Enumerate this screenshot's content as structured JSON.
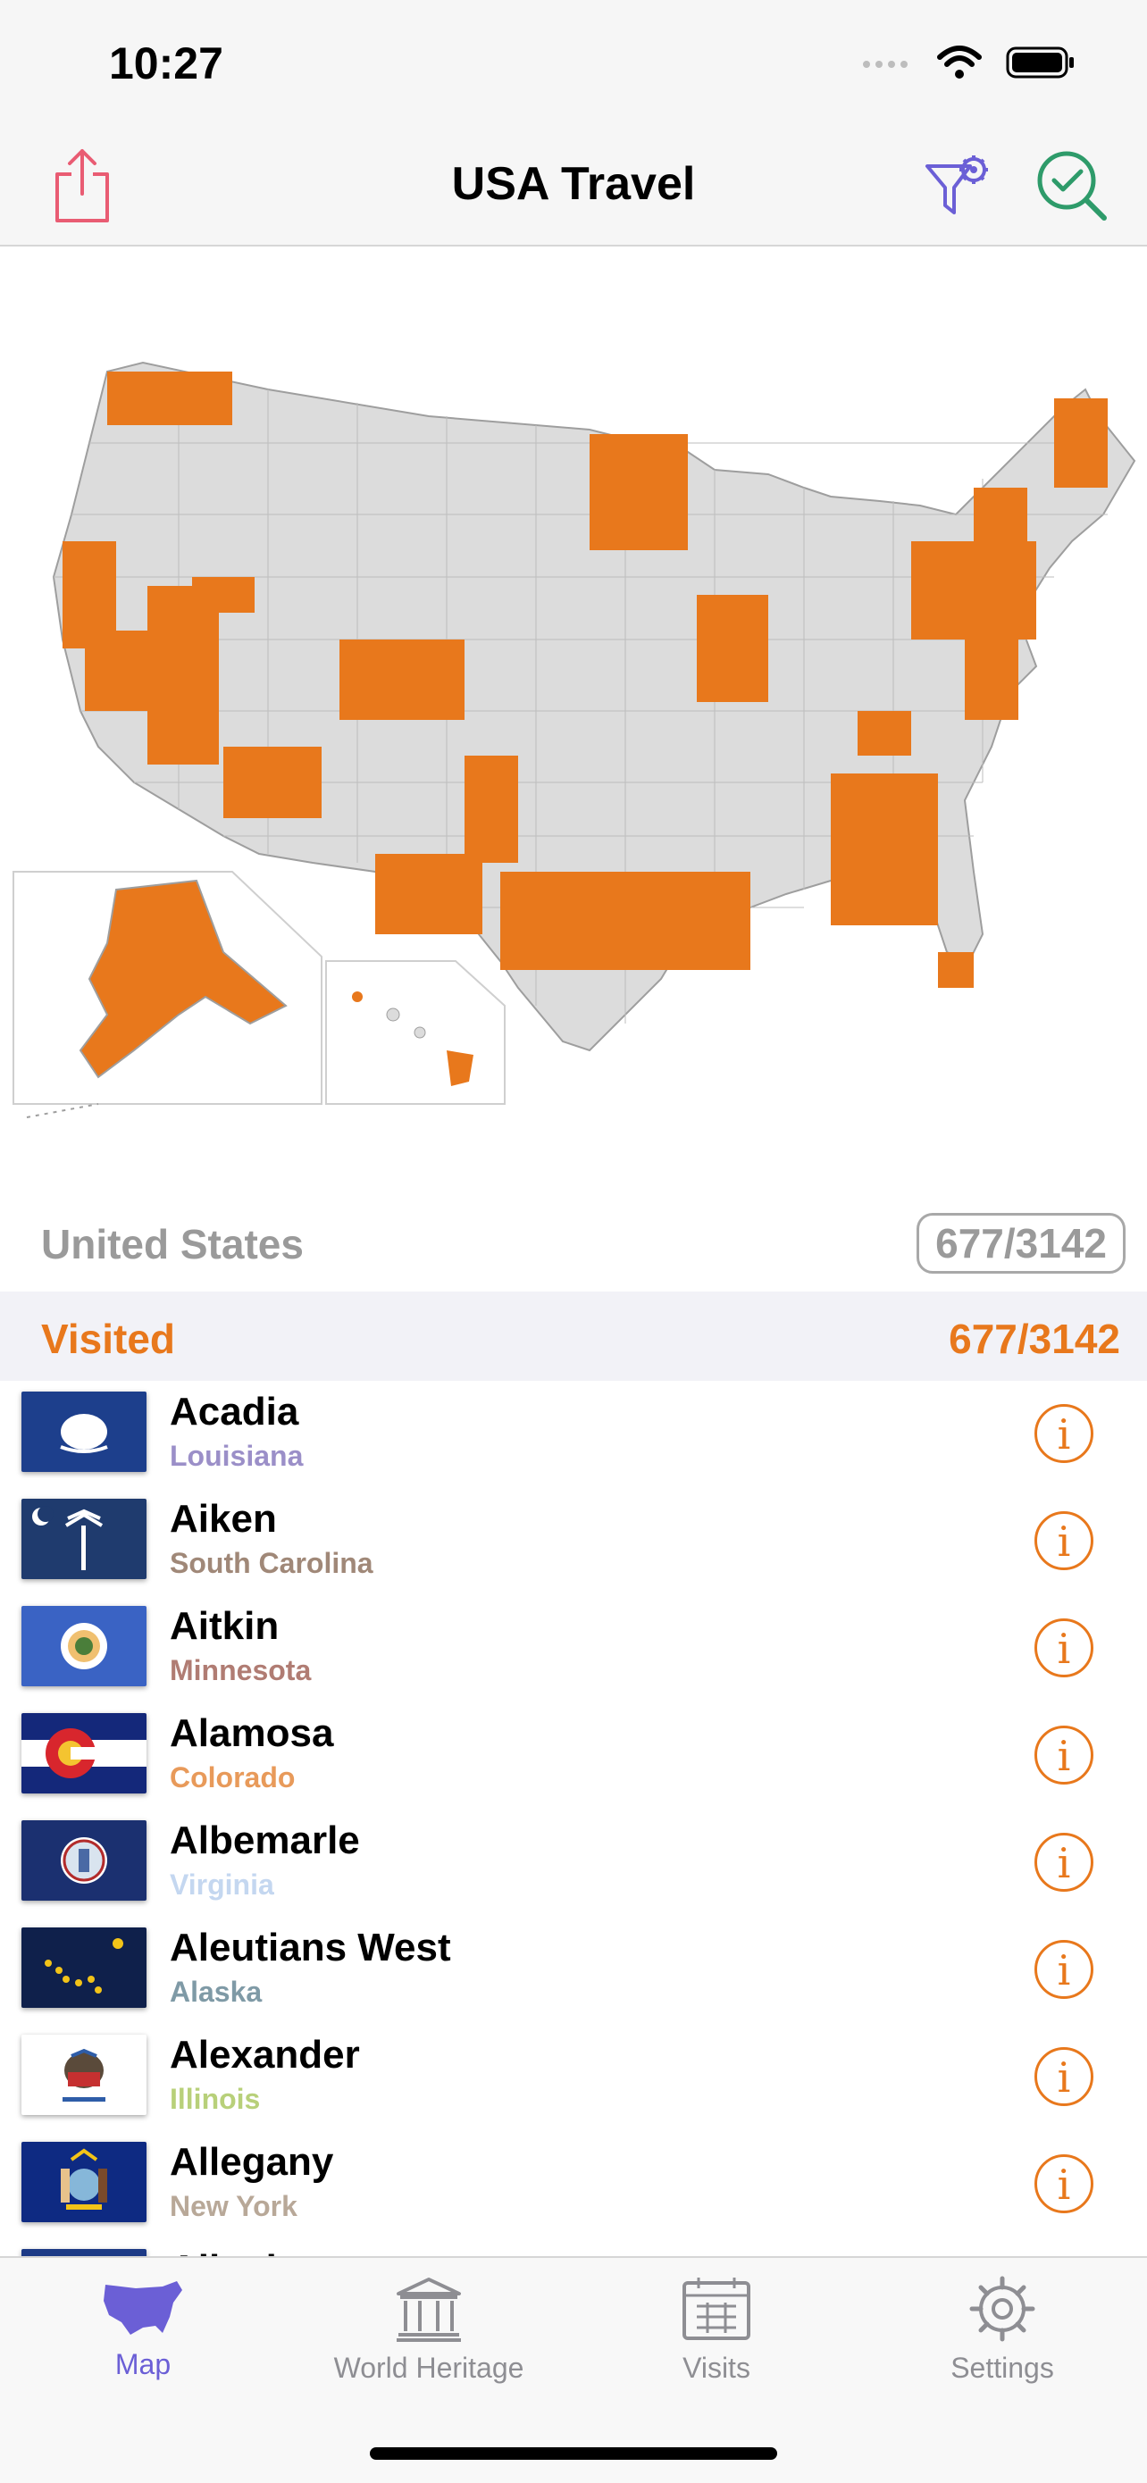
{
  "status_bar": {
    "time": "10:27"
  },
  "nav": {
    "title": "USA Travel"
  },
  "summary": {
    "region": "United States",
    "region_count": "677/3142"
  },
  "visited": {
    "label": "Visited",
    "count": "677/3142"
  },
  "colors": {
    "accent": "#e8781c",
    "visited_fill": "#e8781c",
    "unvisited_fill": "#dcdcdc",
    "tab_active": "#6b5fd6"
  },
  "counties": [
    {
      "name": "Acadia",
      "state": "Louisiana",
      "state_color": "#9b8fc8",
      "flag_icon": "louisiana-flag-icon"
    },
    {
      "name": "Aiken",
      "state": "South Carolina",
      "state_color": "#a08878",
      "flag_icon": "south-carolina-flag-icon"
    },
    {
      "name": "Aitkin",
      "state": "Minnesota",
      "state_color": "#b07c73",
      "flag_icon": "minnesota-flag-icon"
    },
    {
      "name": "Alamosa",
      "state": "Colorado",
      "state_color": "#e89a5a",
      "flag_icon": "colorado-flag-icon"
    },
    {
      "name": "Albemarle",
      "state": "Virginia",
      "state_color": "#c4d7f0",
      "flag_icon": "virginia-flag-icon"
    },
    {
      "name": "Aleutians West",
      "state": "Alaska",
      "state_color": "#7f9aa6",
      "flag_icon": "alaska-flag-icon"
    },
    {
      "name": "Alexander",
      "state": "Illinois",
      "state_color": "#b8d07a",
      "flag_icon": "illinois-flag-icon"
    },
    {
      "name": "Allegany",
      "state": "New York",
      "state_color": "#b8a898",
      "flag_icon": "new-york-flag-icon"
    },
    {
      "name": "Allegheny",
      "state": "",
      "state_color": "#999999",
      "flag_icon": "pennsylvania-flag-icon"
    }
  ],
  "tabs": [
    {
      "label": "Map",
      "icon": "usa-map-icon",
      "active": true
    },
    {
      "label": "World Heritage",
      "icon": "temple-icon",
      "active": false
    },
    {
      "label": "Visits",
      "icon": "calendar-icon",
      "active": false
    },
    {
      "label": "Settings",
      "icon": "gear-icon",
      "active": false
    }
  ]
}
